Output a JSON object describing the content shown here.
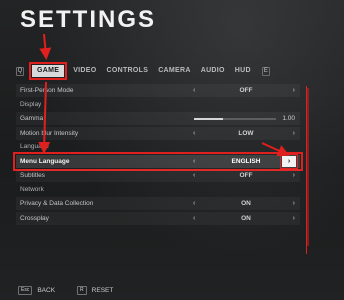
{
  "title": "SETTINGS",
  "tabs": {
    "bumper_left": "Q",
    "bumper_right": "E",
    "items": [
      "GAME",
      "VIDEO",
      "CONTROLS",
      "CAMERA",
      "AUDIO",
      "HUD"
    ]
  },
  "settings": {
    "first_person_mode": {
      "label": "First-Person Mode",
      "value": "OFF"
    },
    "display_section": "Display",
    "gamma": {
      "label": "Gamma",
      "value": "1.00",
      "level": 0.35
    },
    "motion_blur": {
      "label": "Motion blur Intensity",
      "value": "LOW"
    },
    "language_section": "Language",
    "menu_language": {
      "label": "Menu Language",
      "value": "ENGLISH"
    },
    "subtitles": {
      "label": "Subtitles",
      "value": "OFF"
    },
    "network_section": "Network",
    "privacy": {
      "label": "Privacy & Data Collection",
      "value": "ON"
    },
    "crossplay": {
      "label": "Crossplay",
      "value": "ON"
    }
  },
  "arrows": {
    "left": "‹",
    "right": "›"
  },
  "footer": {
    "back_key": "Esc",
    "back_label": "BACK",
    "reset_key": "R",
    "reset_label": "RESET"
  },
  "colors": {
    "annotation_red": "#e0201e",
    "background": "#1c1d1e"
  }
}
